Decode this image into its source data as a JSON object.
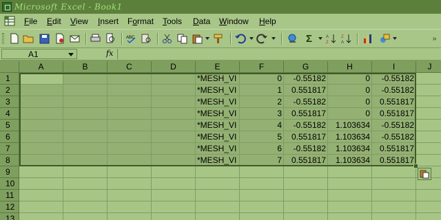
{
  "window": {
    "title": "Microsoft Excel - Book1"
  },
  "menu": {
    "items": [
      {
        "label": "File",
        "ul": "F"
      },
      {
        "label": "Edit",
        "ul": "E"
      },
      {
        "label": "View",
        "ul": "V"
      },
      {
        "label": "Insert",
        "ul": "I"
      },
      {
        "label": "Format",
        "ul": "o"
      },
      {
        "label": "Tools",
        "ul": "T"
      },
      {
        "label": "Data",
        "ul": "D"
      },
      {
        "label": "Window",
        "ul": "W"
      },
      {
        "label": "Help",
        "ul": "H"
      }
    ]
  },
  "toolbar": {
    "buttons": [
      "new-icon",
      "open-icon",
      "save-icon",
      "permission-icon",
      "email-icon",
      "print-icon",
      "print-preview-icon",
      "spelling-icon",
      "research-icon",
      "cut-icon",
      "copy-icon",
      "paste-icon",
      "format-painter-icon",
      "undo-icon",
      "redo-icon",
      "hyperlink-icon",
      "autosum-icon",
      "sort-ascending-icon",
      "sort-descending-icon",
      "chart-wizard-icon",
      "drawing-icon"
    ],
    "autosum_glyph": "Σ"
  },
  "formula_bar": {
    "name_box": "A1",
    "fx_label": "fx",
    "content": ""
  },
  "sheet": {
    "columns": [
      "A",
      "B",
      "C",
      "D",
      "E",
      "F",
      "G",
      "H",
      "I",
      "J"
    ],
    "rows": [
      "1",
      "2",
      "3",
      "4",
      "5",
      "6",
      "7",
      "8",
      "9",
      "10",
      "11",
      "12",
      "13"
    ],
    "data": [
      [
        "",
        "",
        "",
        "",
        "*MESH_VI",
        "0",
        "-0.55182",
        "0",
        "-0.55182"
      ],
      [
        "",
        "",
        "",
        "",
        "*MESH_VI",
        "1",
        "0.551817",
        "0",
        "-0.55182"
      ],
      [
        "",
        "",
        "",
        "",
        "*MESH_VI",
        "2",
        "-0.55182",
        "0",
        "0.551817"
      ],
      [
        "",
        "",
        "",
        "",
        "*MESH_VI",
        "3",
        "0.551817",
        "0",
        "0.551817"
      ],
      [
        "",
        "",
        "",
        "",
        "*MESH_VI",
        "4",
        "-0.55182",
        "1.103634",
        "-0.55182"
      ],
      [
        "",
        "",
        "",
        "",
        "*MESH_VI",
        "5",
        "0.551817",
        "1.103634",
        "-0.55182"
      ],
      [
        "",
        "",
        "",
        "",
        "*MESH_VI",
        "6",
        "-0.55182",
        "1.103634",
        "0.551817"
      ],
      [
        "",
        "",
        "",
        "",
        "*MESH_VI",
        "7",
        "0.551817",
        "1.103634",
        "0.551817"
      ]
    ],
    "selection": "A1:I8"
  },
  "colors": {
    "theme_green": "#7f9f5f",
    "cell_bg": "#a7c686",
    "selection_bg": "#94b173",
    "title_text": "#9fe27a"
  }
}
